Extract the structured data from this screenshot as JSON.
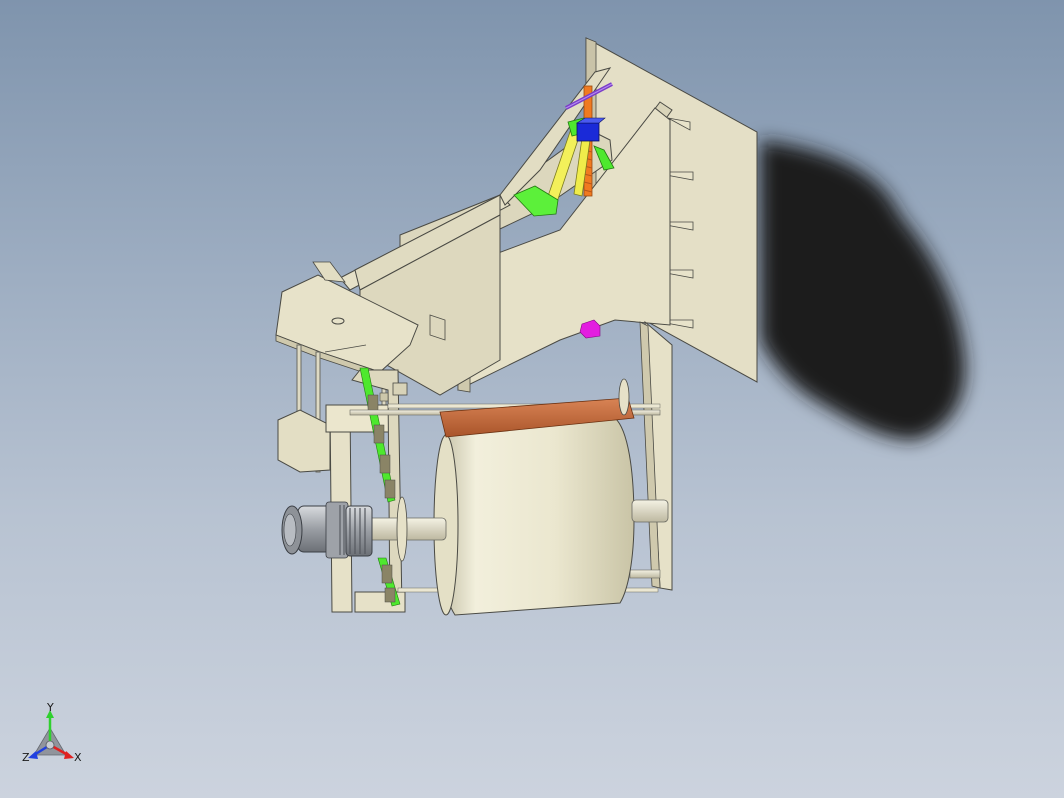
{
  "viewport": {
    "background_top": "#7f94ad",
    "background_bottom": "#ccd3de"
  },
  "model": {
    "body_color": "#e6e1c8",
    "body_dark": "#cfc9ad",
    "edge_color": "#4a4a44",
    "shadow_color": "#1e1e22",
    "accent_green": "#4ee82e",
    "accent_yellow": "#f3f05a",
    "accent_orange": "#f07a20",
    "accent_blue": "#1a2ad8",
    "accent_magenta": "#e31ee0",
    "accent_purple": "#7a3cc8",
    "roller_band": "#c8683a",
    "motor_color": "#a8acb0"
  },
  "triad": {
    "y_label": "Y",
    "z_label": "Z",
    "x_label": "X",
    "y_color": "#2fd02f",
    "x_color": "#e02020",
    "z_color": "#2040e0"
  }
}
